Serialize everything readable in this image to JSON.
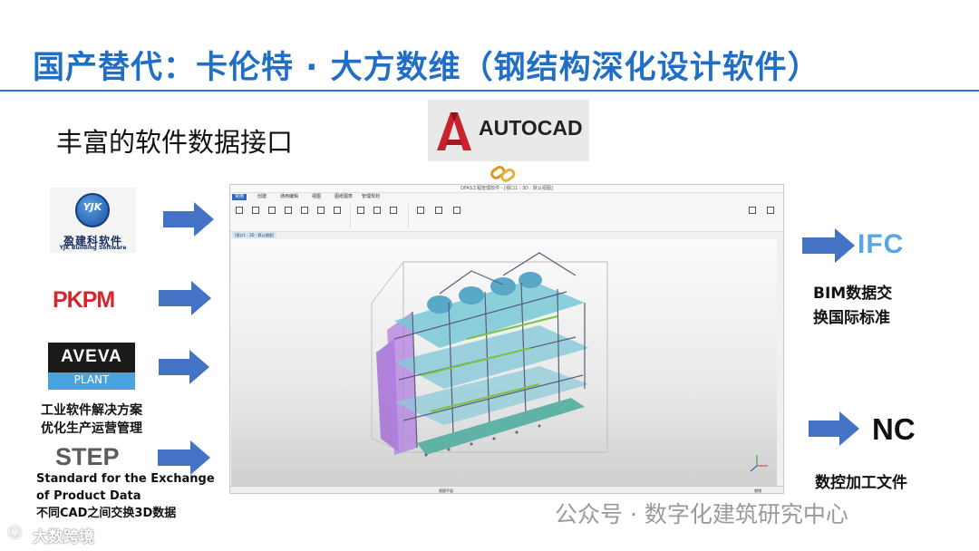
{
  "slide": {
    "title": "国产替代：卡伦特 · 大方数维（钢结构深化设计软件）",
    "subtitle": "丰富的软件数据接口"
  },
  "logos": {
    "autocad": "AUTOCAD",
    "yjk_letters": "YJK",
    "yjk_cn": "盈建科软件",
    "yjk_en": "YJK Building Software",
    "pkpm": "PKPM",
    "aveva_top": "AVEVA",
    "aveva_bottom": "PLANT",
    "step": "STEP",
    "ifc": "IFC",
    "nc": "NC"
  },
  "captions": {
    "aveva_line1": "工业软件解决方案",
    "aveva_line2": "优化生产运营管理",
    "step_line1": "Standard for the Exchange",
    "step_line2": "of Product Data",
    "step_line3": "不同CAD之间交换3D数据",
    "ifc_line1": "BIM数据交",
    "ifc_line2": "换国际标准",
    "nc": "数控加工文件"
  },
  "app": {
    "window_title": "DFAS工程管理软件 - [视口1 : 3D : 默认视图]",
    "tabs": [
      "常用",
      "创建",
      "通用编辑",
      "视图",
      "图纸图表",
      "管理规划"
    ],
    "active_tab": "常用",
    "doc_tab": "[视口1 : 3D : 默认视图]",
    "status_left": "视图平面",
    "status_right": "就绪"
  },
  "watermarks": {
    "wechat": "公众号 · 数字化建筑研究中心",
    "bottom": "大数跨境"
  },
  "colors": {
    "title_blue": "#1f6fc7",
    "arrow_blue": "#4472c4",
    "autocad_red": "#c8232c",
    "pkpm_red": "#d6262b",
    "ifc_blue": "#5aa5e4"
  }
}
